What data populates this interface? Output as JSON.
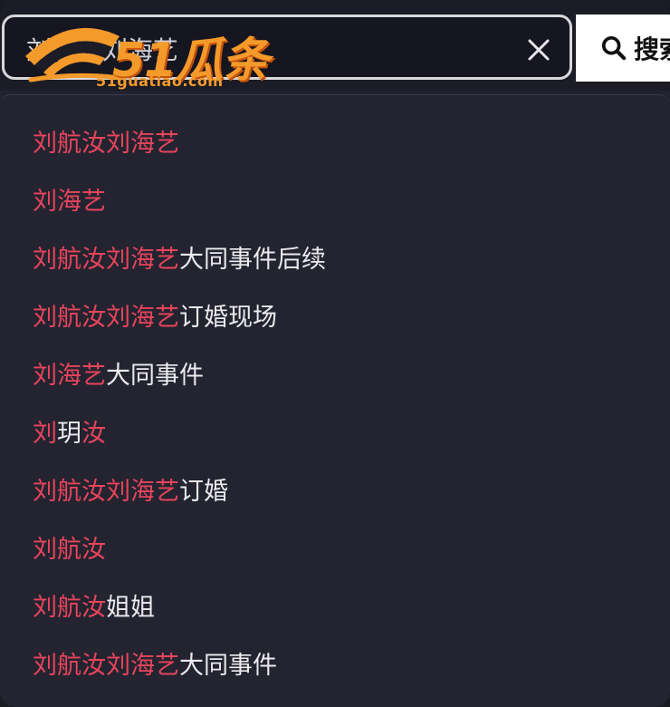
{
  "search": {
    "value": "刘航汝刘海艺",
    "button_label": "搜索"
  },
  "logo": {
    "brand": "51瓜条",
    "domain": "51guatiao.com"
  },
  "colors": {
    "highlight": "#e8445c",
    "text": "#ebebef",
    "panel": "#232430",
    "logo": "#f49a2b"
  },
  "icons": {
    "clear": "close-icon",
    "search": "search-icon"
  },
  "suggestions": [
    {
      "highlight": "刘航汝刘海艺",
      "rest": ""
    },
    {
      "highlight": "刘海艺",
      "rest": ""
    },
    {
      "highlight": "刘航汝刘海艺",
      "rest": "大同事件后续"
    },
    {
      "highlight": "刘航汝刘海艺",
      "rest": "订婚现场"
    },
    {
      "highlight": "刘海艺",
      "rest": "大同事件"
    },
    {
      "highlight": "刘",
      "rest": "玥",
      "highlight2": "汝"
    },
    {
      "highlight": "刘航汝刘海艺",
      "rest": "订婚"
    },
    {
      "highlight": "刘航汝",
      "rest": ""
    },
    {
      "highlight": "刘航汝",
      "rest": "姐姐"
    },
    {
      "highlight": "刘航汝刘海艺",
      "rest": "大同事件"
    }
  ]
}
